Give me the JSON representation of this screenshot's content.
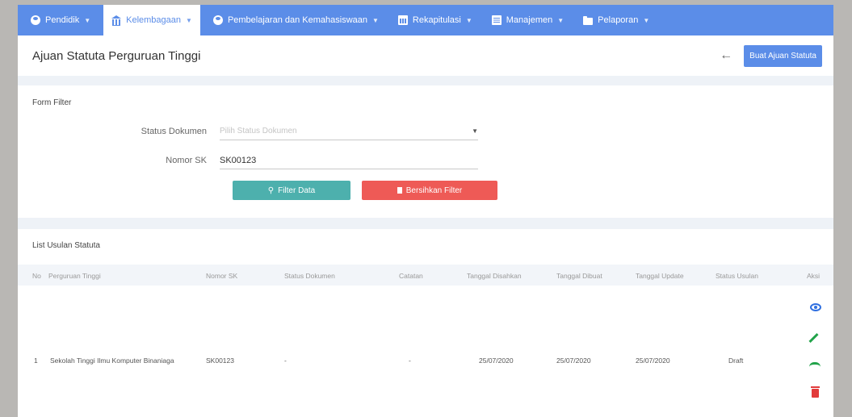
{
  "nav": {
    "items": [
      {
        "label": "Pendidik",
        "icon": "person-icon"
      },
      {
        "label": "Kelembagaan",
        "icon": "institution-icon"
      },
      {
        "label": "Pembelajaran dan Kemahasiswaan",
        "icon": "person-icon"
      },
      {
        "label": "Rekapitulasi",
        "icon": "chart-icon"
      },
      {
        "label": "Manajemen",
        "icon": "document-icon"
      },
      {
        "label": "Pelaporan",
        "icon": "folder-icon"
      }
    ],
    "active_index": 1
  },
  "header": {
    "title": "Ajuan Statuta Perguruan Tinggi",
    "back_symbol": "←",
    "create_button": "Buat Ajuan Statuta"
  },
  "filter": {
    "title": "Form Filter",
    "status_label": "Status Dokumen",
    "status_placeholder": "Pilih Status Dokumen",
    "nomor_label": "Nomor SK",
    "nomor_value": "SK00123",
    "filter_button": "Filter Data",
    "clear_button": "Bersihkan Filter"
  },
  "list": {
    "title": "List Usulan Statuta",
    "columns": [
      "No",
      "Perguruan Tinggi",
      "Nomor SK",
      "Status Dokumen",
      "Catatan",
      "Tanggal Disahkan",
      "Tanggal Dibuat",
      "Tanggal Update",
      "Status Usulan",
      "Aksi"
    ],
    "rows": [
      {
        "no": "1",
        "perguruan_tinggi": "Sekolah Tinggi Ilmu Komputer Binaniaga",
        "nomor_sk": "SK00123",
        "status_dokumen": "-",
        "catatan": "-",
        "tanggal_disahkan": "25/07/2020",
        "tanggal_dibuat": "25/07/2020",
        "tanggal_update": "25/07/2020",
        "status_usulan": "Draft"
      }
    ]
  },
  "colors": {
    "primary": "#5b8de8",
    "teal": "#4db0ad",
    "danger": "#ee5a56",
    "view": "#2f6fe0",
    "edit": "#22a34a",
    "delete": "#e23b3b"
  }
}
